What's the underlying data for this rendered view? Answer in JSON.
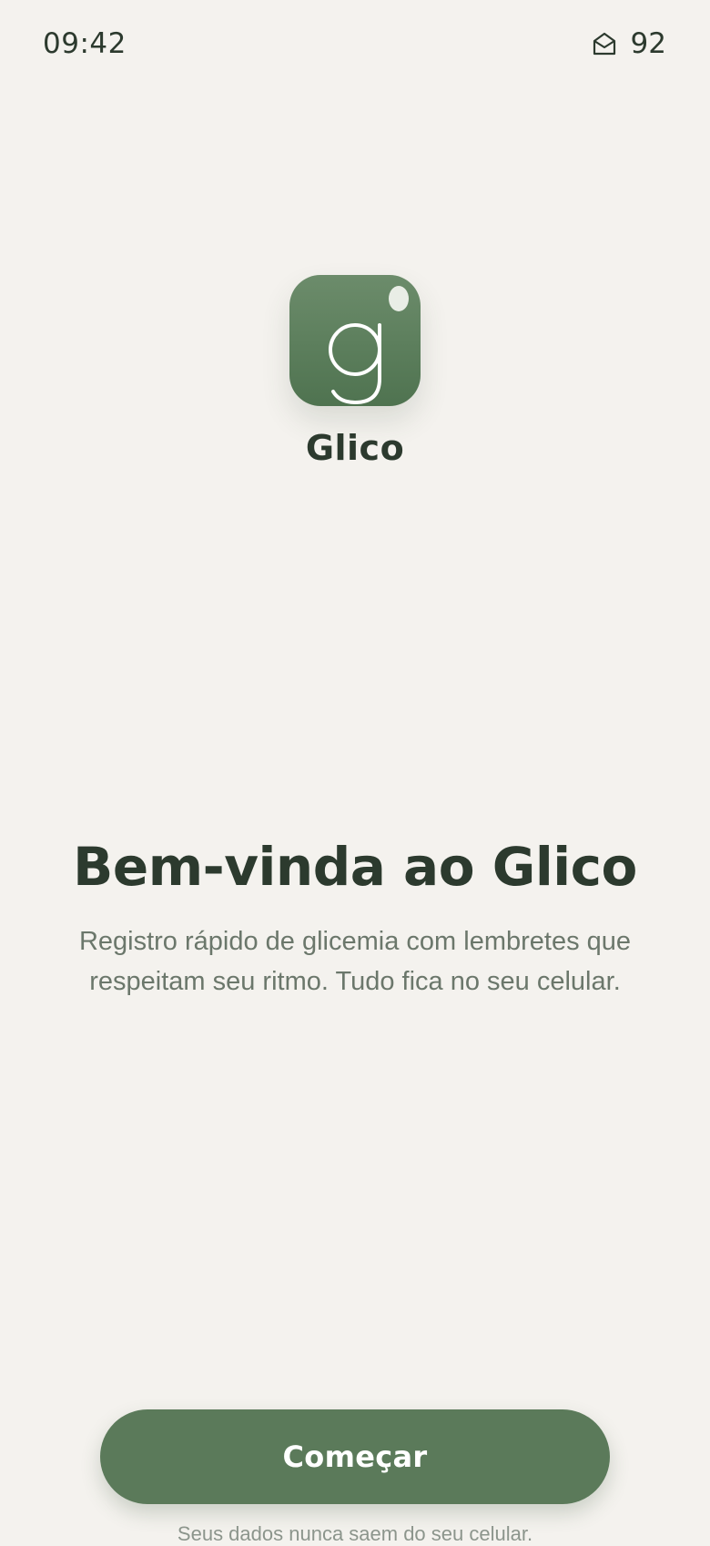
{
  "status_bar": {
    "time": "09:42",
    "icon": "mail-open-icon",
    "battery": "92"
  },
  "app": {
    "icon": "glico-logo-icon",
    "name": "Glico"
  },
  "welcome": {
    "title": "Bem-vinda ao Glico",
    "subtitle": "Registro rápido de glicemia com lembretes que respeitam seu ritmo. Tudo fica no seu celular."
  },
  "actions": {
    "start_label": "Começar"
  },
  "footnote": "Seus dados nunca saem do seu celular.",
  "colors": {
    "background": "#f4f2ee",
    "primary": "#5b7a5a",
    "text": "#2c3a2e",
    "muted": "#6b776b"
  }
}
